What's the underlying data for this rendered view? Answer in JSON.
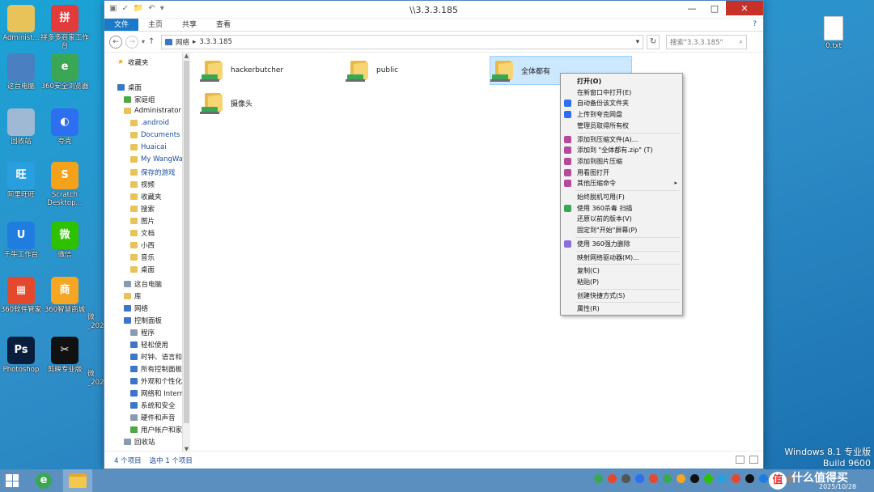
{
  "desktop": {
    "icons": [
      {
        "label": "Administ...",
        "icon": "user-folder-icon",
        "color": "#e8c35a",
        "glyph": ""
      },
      {
        "label": "拼多多商家工作台",
        "icon": "pinduoduo-icon",
        "color": "#e33b3b",
        "glyph": "拼"
      },
      {
        "label": "这台电脑",
        "icon": "computer-icon",
        "color": "#4a7fc1",
        "glyph": ""
      },
      {
        "label": "360安全浏览器",
        "icon": "360-browser-icon",
        "color": "#3aa757",
        "glyph": "e"
      },
      {
        "label": "回收站",
        "icon": "recycle-bin-icon",
        "color": "#9fb8d4",
        "glyph": ""
      },
      {
        "label": "夸克",
        "icon": "quark-icon",
        "color": "#2d6ff0",
        "glyph": "◐"
      },
      {
        "label": "阿里旺旺",
        "icon": "aliwangwang-icon",
        "color": "#2a9fe0",
        "glyph": "旺"
      },
      {
        "label": "Scratch Desktop...",
        "icon": "scratch-icon",
        "color": "#f4a21b",
        "glyph": "S"
      },
      {
        "label": "千牛工作台",
        "icon": "qianniu-icon",
        "color": "#1f7de0",
        "glyph": "U"
      },
      {
        "label": "微信",
        "icon": "wechat-icon",
        "color": "#2dc100",
        "glyph": "微"
      },
      {
        "label": "360软件管家",
        "icon": "360-software-icon",
        "color": "#e5492d",
        "glyph": "▦"
      },
      {
        "label": "360智慧商城",
        "icon": "360-mall-icon",
        "color": "#f5a623",
        "glyph": "商"
      },
      {
        "label": "Photoshop",
        "icon": "photoshop-icon",
        "color": "#0b1d3d",
        "glyph": "Ps"
      },
      {
        "label": "剪映专业版",
        "icon": "capcut-icon",
        "color": "#111111",
        "glyph": "✂"
      }
    ],
    "partial_labels": [
      "微",
      "_202",
      "微",
      "_202"
    ],
    "txt_file_label": "0.txt"
  },
  "window": {
    "title": "\\\\3.3.3.185",
    "quick_access": [
      "▣",
      "✓",
      "📁",
      "↶",
      "▾"
    ],
    "controls": {
      "minimize": "—",
      "maximize": "□",
      "close": "✕"
    },
    "ribbon_tabs": [
      "文件",
      "主页",
      "共享",
      "查看"
    ],
    "help": "?",
    "nav": {
      "back": "←",
      "forward": "→",
      "recent": "▾",
      "up": "↑"
    },
    "address": {
      "crumbs": [
        "网络",
        "3.3.3.185"
      ],
      "separator": "▸",
      "dropdown": "▾",
      "refresh": "↻"
    },
    "search": {
      "placeholder": "搜索\"3.3.3.185\"",
      "icon": "⌕"
    },
    "nav_pane": [
      {
        "label": "收藏夹",
        "icon": "star",
        "indent": 0
      },
      {
        "label": "桌面",
        "icon": "blue",
        "indent": 0
      },
      {
        "label": "家庭组",
        "icon": "green",
        "indent": 1
      },
      {
        "label": "Administrator",
        "icon": "folder",
        "indent": 1
      },
      {
        "label": ".android",
        "icon": "folder",
        "indent": 2
      },
      {
        "label": "Documents",
        "icon": "folder",
        "indent": 2
      },
      {
        "label": "Huaicai",
        "icon": "folder",
        "indent": 2
      },
      {
        "label": "My WangWa",
        "icon": "folder",
        "indent": 2
      },
      {
        "label": "保存的游戏",
        "icon": "folder",
        "indent": 2
      },
      {
        "label": "视频",
        "icon": "folder",
        "indent": 2
      },
      {
        "label": "收藏夹",
        "icon": "folder",
        "indent": 2
      },
      {
        "label": "搜索",
        "icon": "folder",
        "indent": 2
      },
      {
        "label": "图片",
        "icon": "folder",
        "indent": 2
      },
      {
        "label": "文档",
        "icon": "folder",
        "indent": 2
      },
      {
        "label": "小西",
        "icon": "folder",
        "indent": 2
      },
      {
        "label": "音乐",
        "icon": "folder",
        "indent": 2
      },
      {
        "label": "桌面",
        "icon": "folder",
        "indent": 2
      },
      {
        "label": "这台电脑",
        "icon": "grey",
        "indent": 1
      },
      {
        "label": "库",
        "icon": "folder",
        "indent": 1
      },
      {
        "label": "网络",
        "icon": "blue",
        "indent": 1
      },
      {
        "label": "控制面板",
        "icon": "blue",
        "indent": 1
      },
      {
        "label": "程序",
        "icon": "grey",
        "indent": 2
      },
      {
        "label": "轻松使用",
        "icon": "blue",
        "indent": 2
      },
      {
        "label": "时钟、语言和区",
        "icon": "blue",
        "indent": 2
      },
      {
        "label": "所有控制面板项",
        "icon": "blue",
        "indent": 2
      },
      {
        "label": "外观和个性化",
        "icon": "blue",
        "indent": 2
      },
      {
        "label": "网络和 Intern",
        "icon": "blue",
        "indent": 2
      },
      {
        "label": "系统和安全",
        "icon": "blue",
        "indent": 2
      },
      {
        "label": "硬件和声音",
        "icon": "grey",
        "indent": 2
      },
      {
        "label": "用户帐户和家庭",
        "icon": "green",
        "indent": 2
      },
      {
        "label": "回收站",
        "icon": "grey",
        "indent": 1
      }
    ],
    "folders": [
      {
        "name": "hackerbutcher",
        "selected": false
      },
      {
        "name": "public",
        "selected": false
      },
      {
        "name": "全体都有",
        "selected": true
      },
      {
        "name": "摄像头",
        "selected": false
      }
    ],
    "status": {
      "count": "4 个项目",
      "selection": "选中 1 个项目"
    }
  },
  "context_menu": [
    {
      "label": "打开(O)",
      "bold": true
    },
    {
      "label": "在新窗口中打开(E)"
    },
    {
      "label": "自动备份该文件夹",
      "icon_color": "#2d6ff0"
    },
    {
      "label": "上传到夸克网盘",
      "icon_color": "#2d6ff0"
    },
    {
      "label": "管理员取得所有权"
    },
    {
      "sep": true
    },
    {
      "label": "添加到压缩文件(A)...",
      "icon_color": "#b54a9b"
    },
    {
      "label": "添加到 \"全体都有.zip\" (T)",
      "icon_color": "#b54a9b"
    },
    {
      "label": "添加到图片压缩",
      "icon_color": "#b54a9b"
    },
    {
      "label": "用看图打开",
      "icon_color": "#b54a9b"
    },
    {
      "label": "其他压缩命令",
      "icon_color": "#b54a9b",
      "arrow": "▸"
    },
    {
      "sep": true
    },
    {
      "label": "始终脱机可用(F)"
    },
    {
      "label": "使用 360杀毒 扫描",
      "icon_color": "#3aa757"
    },
    {
      "label": "还原以前的版本(V)"
    },
    {
      "label": "固定到\"开始\"屏幕(P)"
    },
    {
      "sep": true
    },
    {
      "label": "使用 360强力删除",
      "icon_color": "#8a6fd8"
    },
    {
      "sep": true
    },
    {
      "label": "映射网络驱动器(M)..."
    },
    {
      "sep": true
    },
    {
      "label": "复制(C)"
    },
    {
      "label": "粘贴(P)"
    },
    {
      "sep": true
    },
    {
      "label": "创建快捷方式(S)"
    },
    {
      "sep": true
    },
    {
      "label": "属性(R)"
    }
  ],
  "taskbar": {
    "apps": [
      "360-browser-icon",
      "file-explorer-icon"
    ],
    "tray_colors": [
      "#3aa757",
      "#e5492d",
      "#555555",
      "#2d6ff0",
      "#e5492d",
      "#3aa757",
      "#f5a623",
      "#111111",
      "#2dc100",
      "#2a9fe0",
      "#e5492d",
      "#111111",
      "#1f7de0",
      "#3aa757",
      "#888888"
    ],
    "date": "2025/10/28"
  },
  "watermark": {
    "edition": "Windows 8.1 专业版",
    "build": "Build 9600",
    "site": "什么值得买",
    "site_logo": "值"
  }
}
